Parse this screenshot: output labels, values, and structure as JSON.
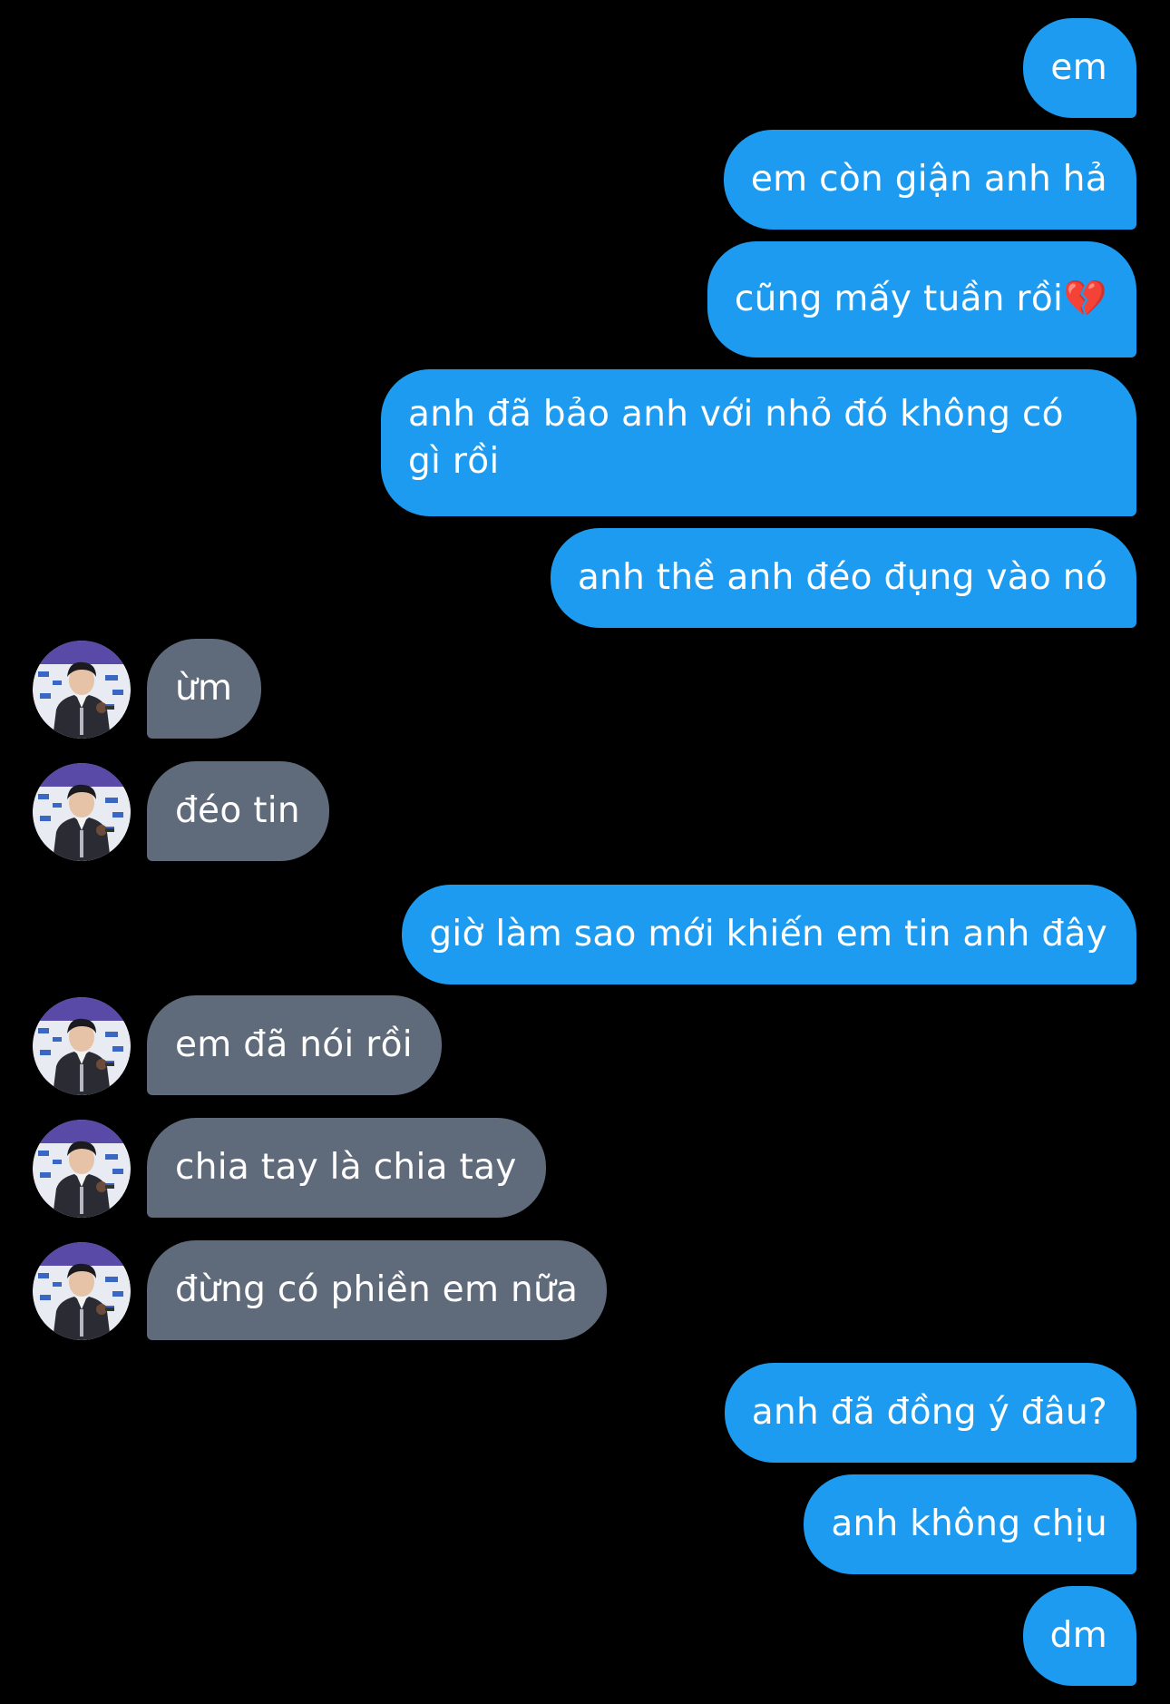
{
  "colors": {
    "background": "#000000",
    "sent_bubble": "#1d9bf0",
    "received_bubble": "#5f6b7a",
    "text": "#ffffff"
  },
  "messages": [
    {
      "sender": "me",
      "text": "em"
    },
    {
      "sender": "me",
      "text": "em còn giận anh hả"
    },
    {
      "sender": "me",
      "text": "cũng mấy tuần rồi💔"
    },
    {
      "sender": "me",
      "text": "anh đã bảo anh với nhỏ đó không có gì rồi"
    },
    {
      "sender": "me",
      "text": "anh thề anh đéo đụng vào nó"
    },
    {
      "sender": "them",
      "text": "ừm",
      "avatar_icon": "user-avatar"
    },
    {
      "sender": "them",
      "text": "đéo tin",
      "avatar_icon": "user-avatar"
    },
    {
      "sender": "me",
      "text": "giờ làm sao mới khiến em tin anh đây"
    },
    {
      "sender": "them",
      "text": "em đã nói rồi",
      "avatar_icon": "user-avatar"
    },
    {
      "sender": "them",
      "text": "chia tay là chia tay",
      "avatar_icon": "user-avatar"
    },
    {
      "sender": "them",
      "text": "đừng có phiền em nữa",
      "avatar_icon": "user-avatar"
    },
    {
      "sender": "me",
      "text": "anh đã đồng ý đâu?"
    },
    {
      "sender": "me",
      "text": "anh không chịu"
    },
    {
      "sender": "me",
      "text": "dm"
    }
  ]
}
